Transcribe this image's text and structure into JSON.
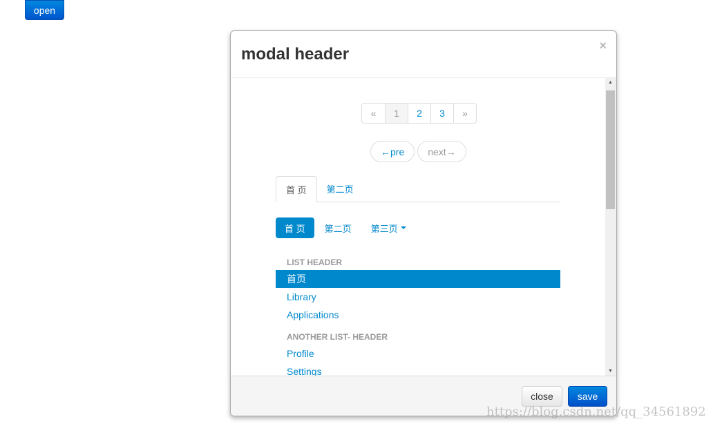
{
  "open_button": "open",
  "modal": {
    "title": "modal header",
    "close_x": "×",
    "pagination": [
      "«",
      "1",
      "2",
      "3",
      "»"
    ],
    "pager": {
      "prev": "←pre",
      "next": "next→"
    },
    "tabs": [
      "首 页",
      "第二页"
    ],
    "pills": [
      "首 页",
      "第二页",
      "第三页"
    ],
    "list": {
      "header1": "LIST HEADER",
      "items1": [
        "首页",
        "Library",
        "Applications"
      ],
      "header2": "ANOTHER LIST- HEADER",
      "items2": [
        "Profile",
        "Settings"
      ]
    },
    "footer": {
      "close": "close",
      "save": "save"
    }
  },
  "watermark": "https://blog.csdn.net/qq_34561892",
  "colors": {
    "accent": "#0088cc",
    "save": "#0055cc"
  }
}
